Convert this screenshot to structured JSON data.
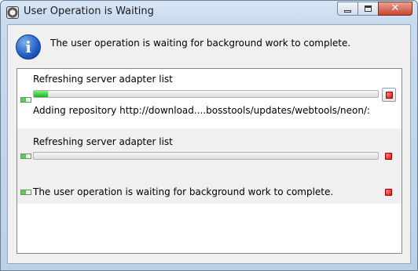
{
  "window": {
    "title": "User Operation is Waiting",
    "buttons": {
      "minimize": "minimize",
      "maximize": "maximize",
      "close": "✕"
    }
  },
  "header": {
    "icon": "info-icon",
    "message": "The user operation is waiting for background work to complete."
  },
  "jobs": [
    {
      "name": "Refreshing server adapter list",
      "progress": 0.04,
      "detail": "Adding repository http://download....bosstools/updates/webtools/neon/:",
      "stop_icon": "stop-icon"
    },
    {
      "name": "Refreshing server adapter list",
      "progress": 0,
      "detail": "",
      "stop_icon": "stop-icon"
    },
    {
      "name": "The user operation is waiting for background work to complete.",
      "progress": null,
      "detail": "",
      "stop_icon": "stop-icon"
    }
  ],
  "colors": {
    "progress_fill": "#17b617",
    "stop_red": "#d01515",
    "info_blue": "#1f5cc4"
  }
}
